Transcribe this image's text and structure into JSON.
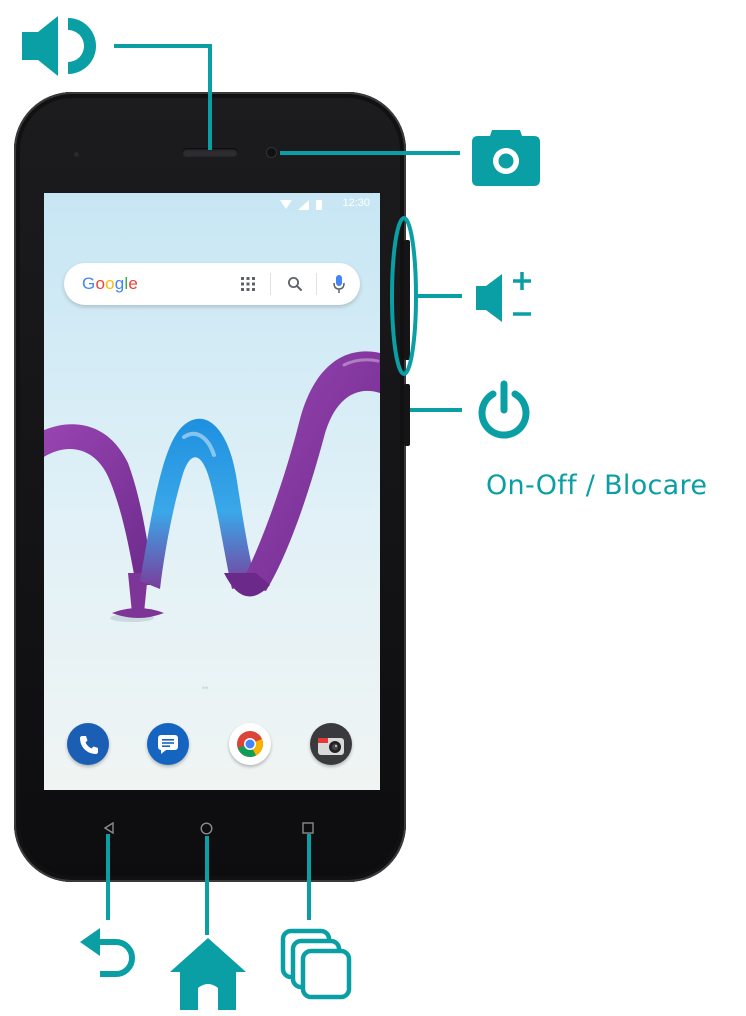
{
  "device": {
    "status_time": "12:30",
    "search_bar": {
      "brand_letters": [
        "G",
        "o",
        "o",
        "g",
        "l",
        "e"
      ]
    },
    "dock_apps": [
      "phone-app",
      "messages-app",
      "chrome-app",
      "camera-app"
    ],
    "nav_keys": [
      "back",
      "home",
      "recents"
    ]
  },
  "callouts": {
    "power_label": "On-Off / Blocare",
    "icons": [
      "speaker-icon",
      "camera-icon",
      "volume-icon",
      "power-icon",
      "back-icon",
      "home-icon",
      "recents-icon"
    ]
  },
  "colors": {
    "accent": "#0a9fa5",
    "phone_body": "#111113",
    "screen_sky": "#c7e6f4",
    "logo_purple": "#7b2f94",
    "logo_blue": "#1f8fd6",
    "google_blue": "#4285F4",
    "google_red": "#EA4335",
    "google_yellow": "#FBBC05",
    "google_green": "#34A853",
    "phone_app": "#1a5fb4",
    "messages_app": "#1565c0"
  }
}
